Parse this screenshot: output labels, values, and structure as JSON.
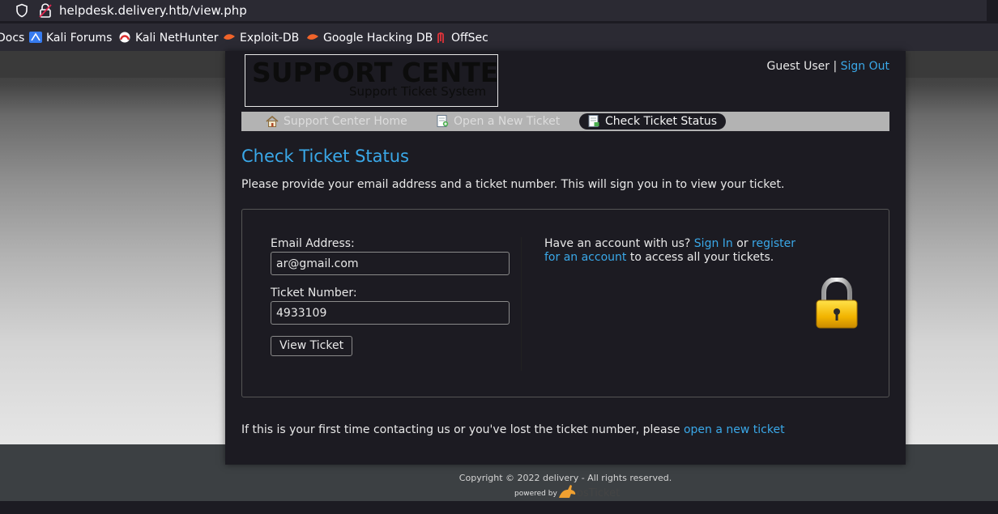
{
  "browser": {
    "url": "helpdesk.delivery.htb/view.php",
    "bookmarks": [
      {
        "label": "Docs",
        "icon": "none"
      },
      {
        "label": "Kali Forums",
        "icon": "kali-forums-icon"
      },
      {
        "label": "Kali NetHunter",
        "icon": "kali-nethunter-icon"
      },
      {
        "label": "Exploit-DB",
        "icon": "exploit-db-icon"
      },
      {
        "label": "Google Hacking DB",
        "icon": "ghdb-icon"
      },
      {
        "label": "OffSec",
        "icon": "offsec-icon"
      }
    ]
  },
  "header": {
    "logo_title": "SUPPORT CENTER",
    "logo_subtitle": "Support Ticket System",
    "guest_label": "Guest User",
    "separator": "|",
    "sign_out": "Sign Out"
  },
  "nav": {
    "tabs": [
      {
        "label": "Support Center Home",
        "icon": "home-icon",
        "active": false
      },
      {
        "label": "Open a New Ticket",
        "icon": "new-ticket-icon",
        "active": false
      },
      {
        "label": "Check Ticket Status",
        "icon": "ticket-status-icon",
        "active": true
      }
    ]
  },
  "main": {
    "title": "Check Ticket Status",
    "intro": "Please provide your email address and a ticket number. This will sign you in to view your ticket.",
    "form": {
      "email_label": "Email Address:",
      "email_value": "ar@gmail.com",
      "ticket_label": "Ticket Number:",
      "ticket_value": "4933109",
      "submit_label": "View Ticket"
    },
    "account": {
      "prefix": "Have an account with us?",
      "sign_in": "Sign In",
      "or": "or",
      "register": "register for an account",
      "suffix": "to access all your tickets."
    },
    "first_time": {
      "text": "If this is your first time contacting us or you've lost the ticket number, please",
      "link": "open a new ticket"
    }
  },
  "footer": {
    "copyright": "Copyright © 2022 delivery - All rights reserved.",
    "powered_by": "powered by",
    "brand": "osTicket"
  },
  "colors": {
    "link": "#3aa8e8",
    "panel": "#1c1b22",
    "nav_bar": "#b3b3b3"
  }
}
